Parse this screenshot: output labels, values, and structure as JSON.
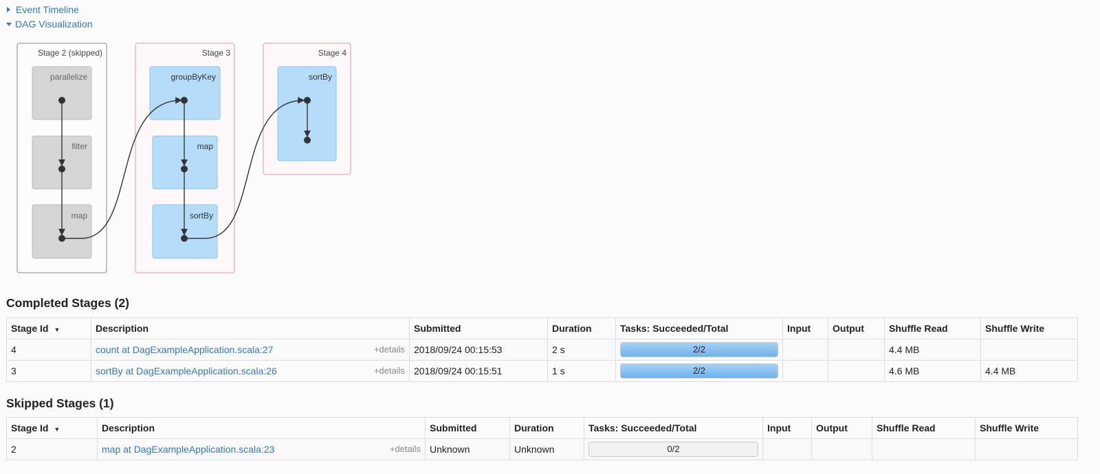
{
  "toggles": {
    "event_timeline": "Event Timeline",
    "dag_visualization": "DAG Visualization"
  },
  "dag": {
    "stages": [
      {
        "label": "Stage 2 (skipped)",
        "status": "skipped",
        "nodes": [
          "parallelize",
          "filter",
          "map"
        ]
      },
      {
        "label": "Stage 3",
        "status": "active",
        "nodes": [
          "groupByKey",
          "map",
          "sortBy"
        ]
      },
      {
        "label": "Stage 4",
        "status": "active",
        "nodes": [
          "sortBy"
        ]
      }
    ],
    "colors": {
      "skipped_border": "#888888",
      "active_border": "#e297a8",
      "skipped_node": "#d5d5d5",
      "active_node": "#b5dcf9",
      "edge": "#333333"
    }
  },
  "completed": {
    "title": "Completed Stages (2)",
    "headers": [
      "Stage Id",
      "Description",
      "Submitted",
      "Duration",
      "Tasks: Succeeded/Total",
      "Input",
      "Output",
      "Shuffle Read",
      "Shuffle Write"
    ],
    "sort_arrow": "▼",
    "details_label": "+details",
    "rows": [
      {
        "id": "4",
        "desc": "count at DagExampleApplication.scala:27",
        "submitted": "2018/09/24 00:15:53",
        "duration": "2 s",
        "tasks": "2/2",
        "progress": 1.0,
        "input": "",
        "output": "",
        "read": "4.4 MB",
        "write": ""
      },
      {
        "id": "3",
        "desc": "sortBy at DagExampleApplication.scala:26",
        "submitted": "2018/09/24 00:15:51",
        "duration": "1 s",
        "tasks": "2/2",
        "progress": 1.0,
        "input": "",
        "output": "",
        "read": "4.6 MB",
        "write": "4.4 MB"
      }
    ]
  },
  "skipped": {
    "title": "Skipped Stages (1)",
    "headers": [
      "Stage Id",
      "Description",
      "Submitted",
      "Duration",
      "Tasks: Succeeded/Total",
      "Input",
      "Output",
      "Shuffle Read",
      "Shuffle Write"
    ],
    "sort_arrow": "▼",
    "details_label": "+details",
    "rows": [
      {
        "id": "2",
        "desc": "map at DagExampleApplication.scala:23",
        "submitted": "Unknown",
        "duration": "Unknown",
        "tasks": "0/2",
        "progress": 0.0,
        "input": "",
        "output": "",
        "read": "",
        "write": ""
      }
    ]
  }
}
